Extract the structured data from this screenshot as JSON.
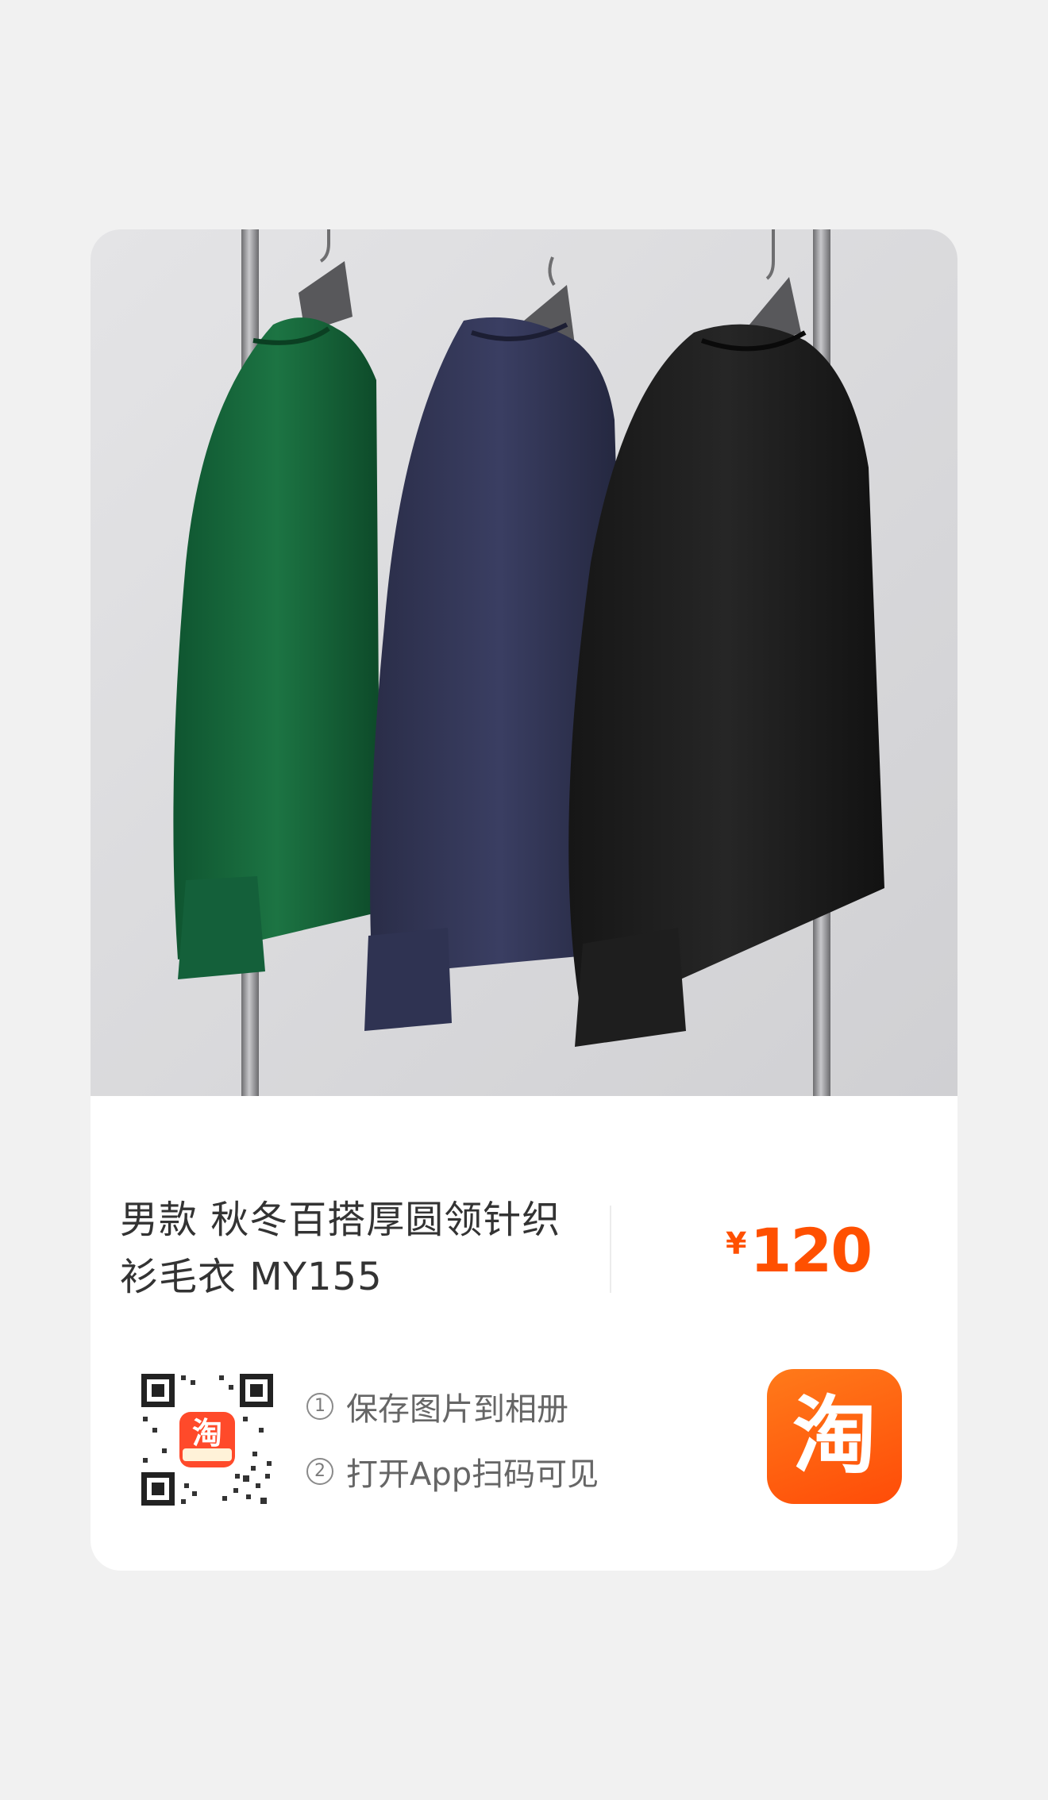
{
  "product": {
    "image_alt": "三件针织衫挂在衣架上",
    "title": "男款 秋冬百搭厚圆领针织衫毛衣 MY155",
    "currency_symbol": "¥",
    "price": "120"
  },
  "share": {
    "step1_num": "1",
    "step1_label": "保存图片到相册",
    "step2_num": "2",
    "step2_label": "打开App扫码可见",
    "app_icon_glyph": "淘",
    "qr_badge_glyph": "淘"
  },
  "colors": {
    "accent": "#ff5000",
    "background": "#f1f1f1",
    "card": "#ffffff"
  }
}
